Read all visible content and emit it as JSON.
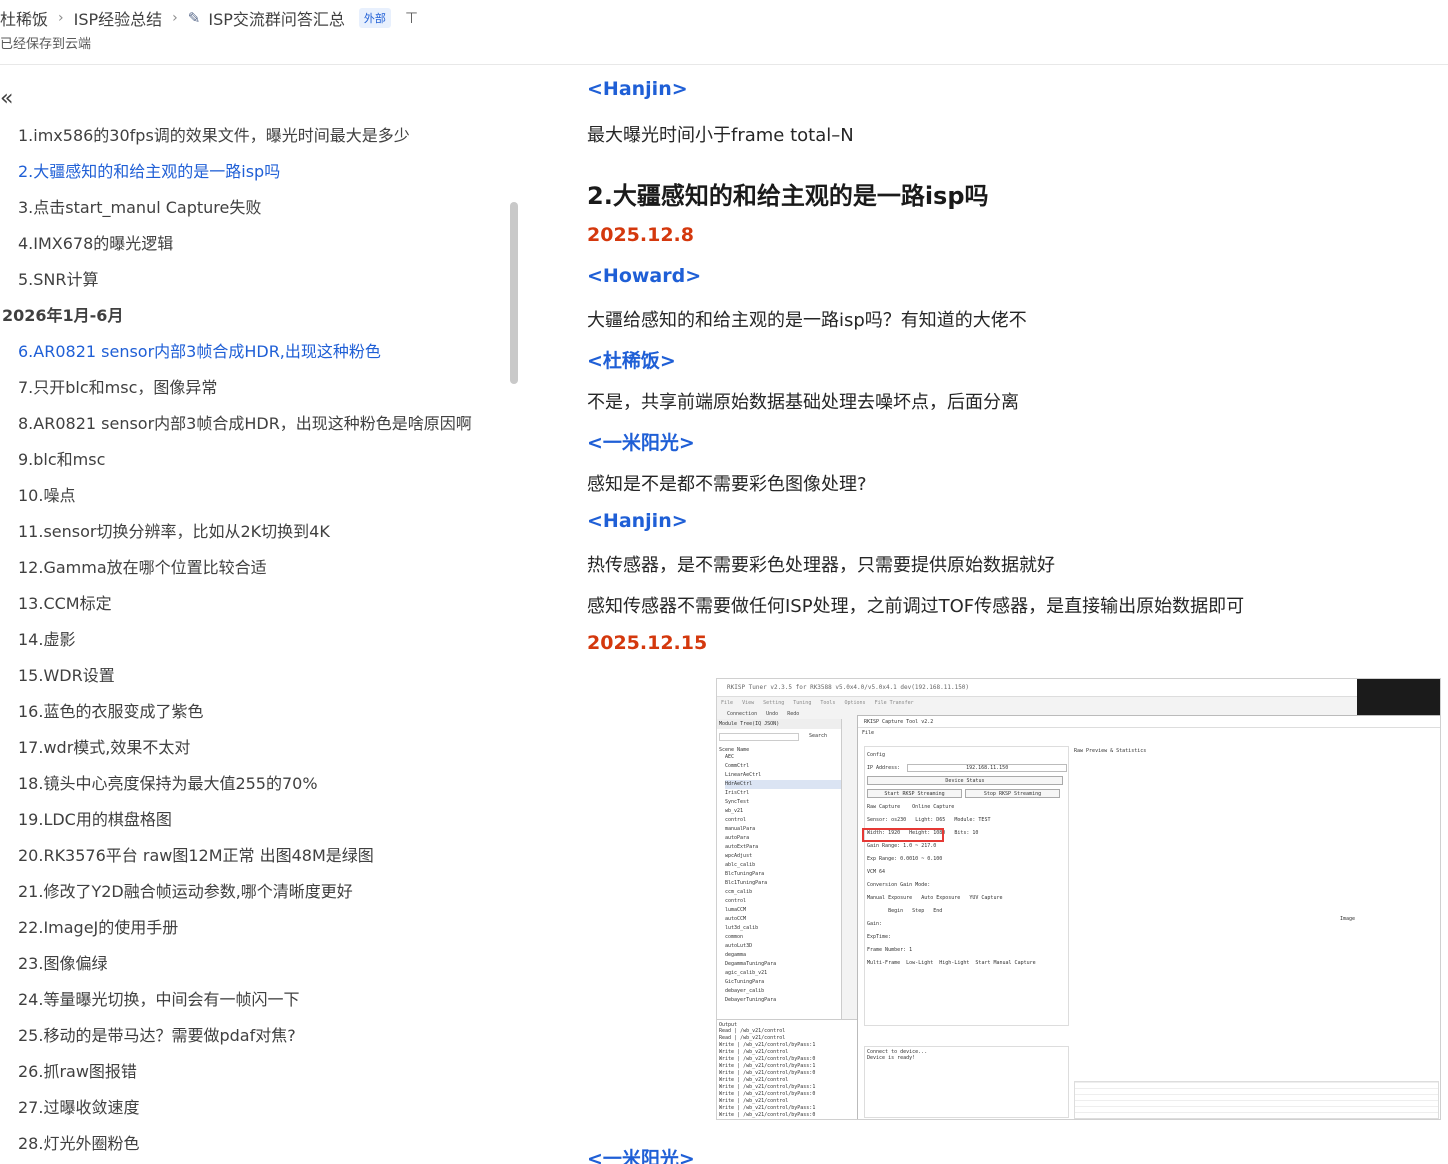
{
  "header": {
    "breadcrumb": [
      "杜稀饭",
      "ISP经验总结",
      "ISP交流群问答汇总"
    ],
    "badge": "外部",
    "saved_status": "已经保存到云端"
  },
  "toc": {
    "items": [
      {
        "label": "1.imx586的30fps调的效果文件，曝光时间最大是多少",
        "type": "item"
      },
      {
        "label": "2.大疆感知的和给主观的是一路isp吗",
        "type": "item",
        "active": true
      },
      {
        "label": "3.点击start_manul Capture失败",
        "type": "item"
      },
      {
        "label": "4.IMX678的曝光逻辑",
        "type": "item"
      },
      {
        "label": "5.SNR计算",
        "type": "item"
      },
      {
        "label": "2026年1月-6月",
        "type": "group"
      },
      {
        "label": "6.AR0821 sensor内部3帧合成HDR,出现这种粉色",
        "type": "item",
        "active": true
      },
      {
        "label": "7.只开blc和msc，图像异常",
        "type": "item"
      },
      {
        "label": "8.AR0821 sensor内部3帧合成HDR，出现这种粉色是啥原因啊",
        "type": "item"
      },
      {
        "label": "9.blc和msc",
        "type": "item"
      },
      {
        "label": "10.噪点",
        "type": "item"
      },
      {
        "label": "11.sensor切换分辨率，比如从2K切换到4K",
        "type": "item"
      },
      {
        "label": "12.Gamma放在哪个位置比较合适",
        "type": "item"
      },
      {
        "label": "13.CCM标定",
        "type": "item"
      },
      {
        "label": "14.虚影",
        "type": "item"
      },
      {
        "label": "15.WDR设置",
        "type": "item"
      },
      {
        "label": "16.蓝色的衣服变成了紫色",
        "type": "item"
      },
      {
        "label": "17.wdr模式,效果不太对",
        "type": "item"
      },
      {
        "label": "18.镜头中心亮度保持为最大值255的70%",
        "type": "item"
      },
      {
        "label": "19.LDC用的棋盘格图",
        "type": "item"
      },
      {
        "label": "20.RK3576平台 raw图12M正常 出图48M是绿图",
        "type": "item"
      },
      {
        "label": "21.修改了Y2D融合帧运动参数,哪个清晰度更好",
        "type": "item"
      },
      {
        "label": "22.ImageJ的使用手册",
        "type": "item"
      },
      {
        "label": "23.图像偏绿",
        "type": "item"
      },
      {
        "label": "24.等量曝光切换，中间会有一帧闪一下",
        "type": "item"
      },
      {
        "label": "25.移动的是带马达？需要做pdaf对焦?",
        "type": "item"
      },
      {
        "label": "26.抓raw图报错",
        "type": "item"
      },
      {
        "label": "27.过曝收敛速度",
        "type": "item"
      },
      {
        "label": "28.灯光外圈粉色",
        "type": "item"
      }
    ]
  },
  "content": {
    "blocks": [
      {
        "kind": "speaker",
        "text": "<Hanjin>"
      },
      {
        "kind": "para",
        "text": "最大曝光时间小于frame total–N"
      },
      {
        "kind": "h2",
        "text": "2.大疆感知的和给主观的是一路isp吗"
      },
      {
        "kind": "date",
        "text": "2025.12.8"
      },
      {
        "kind": "speaker",
        "text": "<Howard>"
      },
      {
        "kind": "para",
        "text": "大疆给感知的和给主观的是一路isp吗？有知道的大佬不"
      },
      {
        "kind": "speaker",
        "text": "<杜稀饭>"
      },
      {
        "kind": "para",
        "text": "不是，共享前端原始数据基础处理去噪坏点，后面分离"
      },
      {
        "kind": "speaker",
        "text": "<一米阳光>"
      },
      {
        "kind": "para",
        "text": "感知是不是都不需要彩色图像处理?"
      },
      {
        "kind": "speaker",
        "text": "<Hanjin>"
      },
      {
        "kind": "para",
        "text": "热传感器，是不需要彩色处理器，只需要提供原始数据就好"
      },
      {
        "kind": "para",
        "text": "感知传感器不需要做任何ISP处理，之前调过TOF传感器，是直接输出原始数据即可"
      },
      {
        "kind": "date",
        "text": "2025.12.15"
      },
      {
        "kind": "speaker",
        "text": "<一米阳光>"
      }
    ],
    "screenshot": {
      "title": "RKISP Tuner v2.3.5 for RK3588 v5.0x4.0/v5.0x4.1 dev(192.168.11.150)",
      "menu": [
        "File",
        "View",
        "Setting",
        "Tuning",
        "Tools",
        "Options",
        "File Transfer"
      ],
      "tools": [
        "Connection",
        "Undo",
        "Redo"
      ],
      "tree_title": "Module Tree(IQ JSON)",
      "search_btn": "Search",
      "tree_header": "Scene Name",
      "tree_nodes": [
        "AEC",
        "CommCtrl",
        "LinearAeCtrl",
        "HdrAeCtrl",
        "IrisCtrl",
        "SyncTest",
        "wb_v21",
        "control",
        "manualPara",
        "autoPara",
        "autoExtPara",
        "wpcAdjust",
        "ablc_calib",
        "BlcTuningPara",
        "Blc1TuningPara",
        "ccm_calib",
        "control",
        "lumaCCM",
        "autoCCM",
        "lut3d_calib",
        "common",
        "autoLut3D",
        "degamma",
        "DegammaTuningPara",
        "agic_calib_v21",
        "GicTuningPara",
        "debayer_calib",
        "DebayerTuningPara"
      ],
      "capture_title": "RKISP Capture Tool v2.2",
      "capture_file": "File",
      "config_label": "Config",
      "ip_label": "IP Address:",
      "ip_value": "192.168.11.150",
      "device_status": "Device Status",
      "start_btn": "Start RKSP Streaming",
      "stop_btn": "Stop RKSP Streaming",
      "raw_capture": "Raw Capture",
      "online_capture": "Online Capture",
      "sensor_label": "Sensor:",
      "sensor_value": "os230",
      "light_label": "Light:",
      "light_value": "D65",
      "module_label": "Module:",
      "module_value": "TEST",
      "width_label": "Width:",
      "width_value": "1920",
      "height_label": "Height:",
      "height_value": "1080",
      "bits_label": "Bits:",
      "bits_value": "10",
      "gain_range": "Gain Range:",
      "gain_min": "1.0",
      "gain_max": "217.0",
      "exp_range": "Exp Range:",
      "exp_min": "0.0010",
      "exp_max": "0.100",
      "vcm_label": "VCM",
      "vcm_value": "64",
      "conv_gain": "Conversion Gain Mode:",
      "manual_exposure": "Manual Exposure",
      "auto_exposure": "Auto Exposure",
      "yuv_capture": "YUV Capture",
      "begin": "Begin",
      "end": "End",
      "step": "Step",
      "gain_label": "Gain:",
      "exptime_label": "ExpTime:",
      "frame_number": "Frame Number:",
      "frame_value": "1",
      "multi_frame": "Multi-Frame",
      "low_light": "Low-Light",
      "high_light": "High-Light",
      "start_manual": "Start Manual Capture",
      "connect_msg": "Connect to device...",
      "device_ready": "Device is ready!",
      "raw_preview": "Raw Preview & Statistics",
      "image_label": "Image",
      "output_label": "Output",
      "console_lines": [
        "Read | /wb_v21/control",
        "Read | /wb_v21/control",
        "Write | /wb_v21/control/byPass:1",
        "Write | /wb_v21/control",
        "Write | /wb_v21/control/byPass:0",
        "Write | /wb_v21/control/byPass:1",
        "Write | /wb_v21/control/byPass:0",
        "Write | /wb_v21/control",
        "Write | /wb_v21/control/byPass:1",
        "Write | /wb_v21/control/byPass:0",
        "Write | /wb_v21/control",
        "Write | /wb_v21/control/byPass:1",
        "Write | /wb_v21/control/byPass:0"
      ]
    }
  }
}
